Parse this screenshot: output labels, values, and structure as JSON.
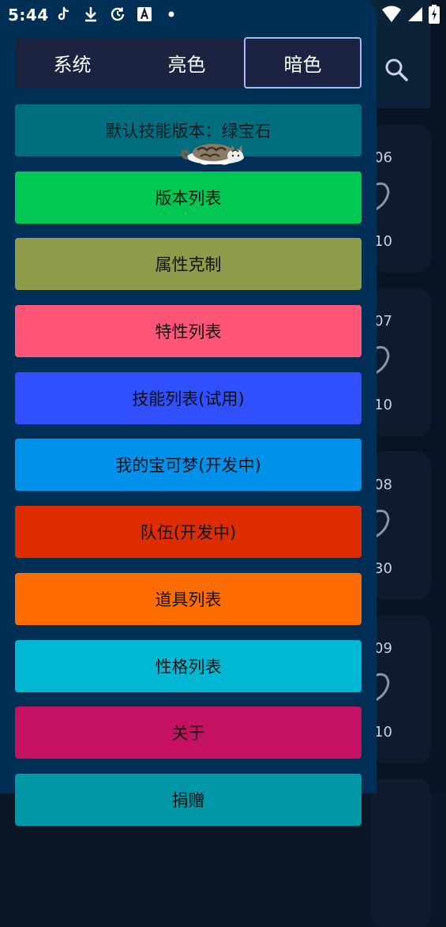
{
  "status_bar": {
    "time": "5:44",
    "icons": [
      "tiktok-icon",
      "download-icon",
      "sync-icon",
      "font-a-icon",
      "dot-icon",
      "wifi-icon",
      "signal-icon",
      "battery-icon"
    ]
  },
  "background": {
    "cards": [
      {
        "top_number": "06",
        "bottom_number": "10"
      },
      {
        "top_number": "07",
        "bottom_number": "10"
      },
      {
        "top_number": "08",
        "bottom_number": "30"
      },
      {
        "top_number": "09",
        "bottom_number": "10"
      }
    ]
  },
  "drawer": {
    "theme_tabs": [
      {
        "label": "系统",
        "selected": false
      },
      {
        "label": "亮色",
        "selected": false
      },
      {
        "label": "暗色",
        "selected": true
      }
    ],
    "menu_items": [
      {
        "label": "默认技能版本：绿宝石",
        "color": "#006e7f"
      },
      {
        "label": "版本列表",
        "color": "#00c853"
      },
      {
        "label": "属性克制",
        "color": "#8d9b4a"
      },
      {
        "label": "特性列表",
        "color": "#ff5577"
      },
      {
        "label": "技能列表(试用)",
        "color": "#304ffe"
      },
      {
        "label": "我的宝可梦(开发中)",
        "color": "#0091ea"
      },
      {
        "label": "队伍(开发中)",
        "color": "#dd2c00"
      },
      {
        "label": "道具列表",
        "color": "#ff6d00"
      },
      {
        "label": "性格列表",
        "color": "#00b8d4"
      },
      {
        "label": "关于",
        "color": "#c51162"
      },
      {
        "label": "捐赠",
        "color": "#0097a7"
      }
    ]
  },
  "colors": {
    "drawer_bg": "#002f55",
    "tabs_bg": "#1b2340",
    "selected_tab_border": "#a9b8f2",
    "app_bg": "#0a1322",
    "header_bg": "#0c2238",
    "card_bg": "#101a2e"
  }
}
